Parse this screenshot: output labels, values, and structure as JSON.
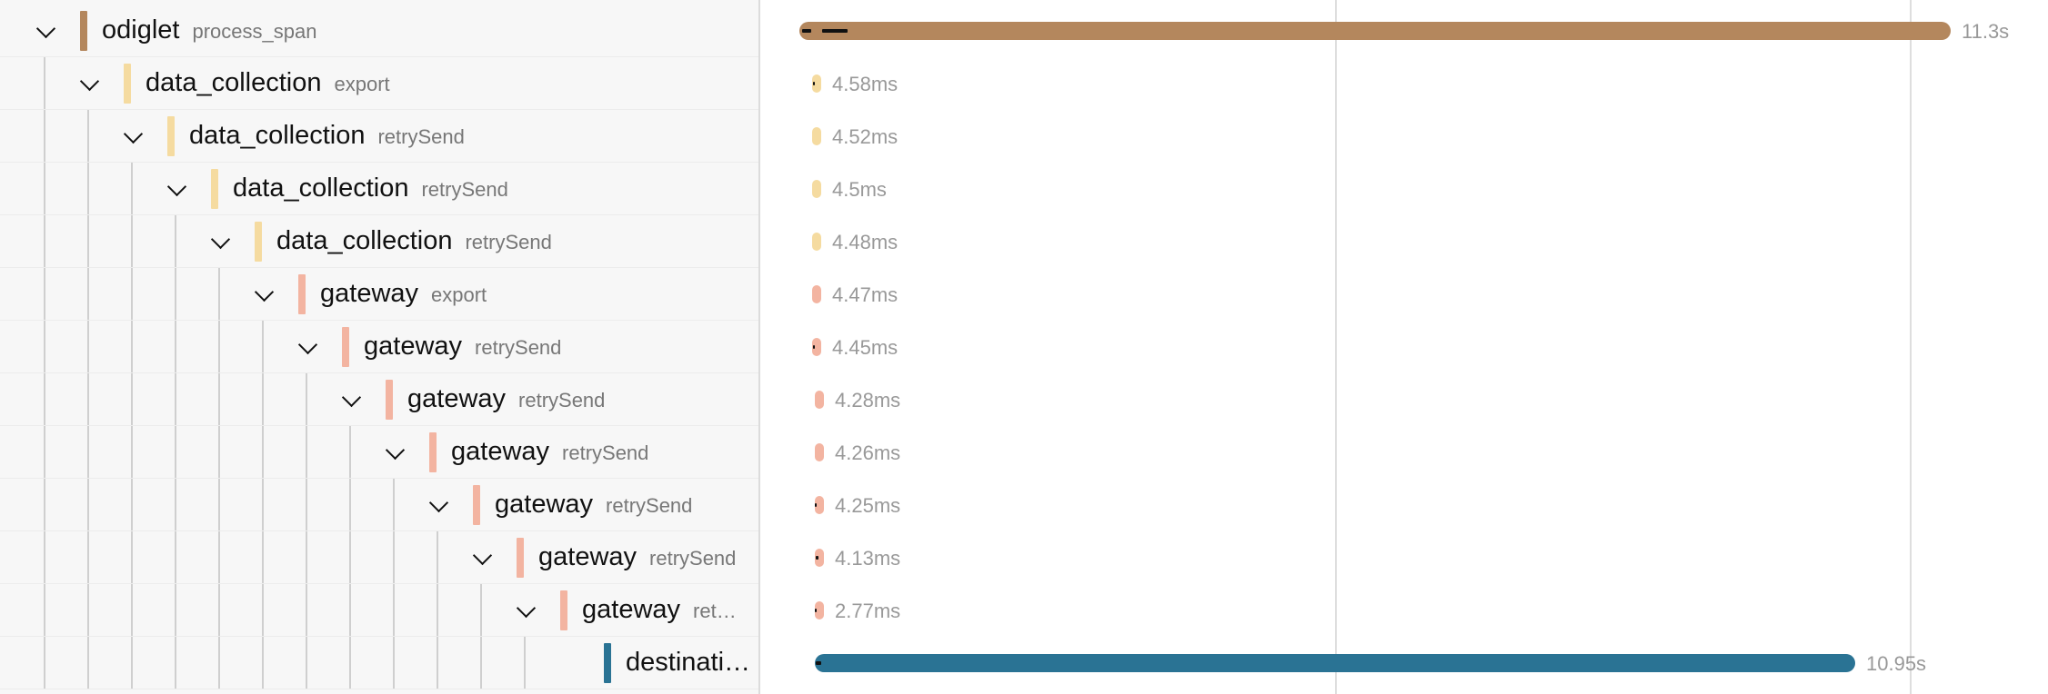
{
  "colors": {
    "odiglet": "#b4875d",
    "data_collection": "#f5dba0",
    "gateway": "#f3b4a1",
    "destination": "#2a7394"
  },
  "icons": {
    "expand": "chevron-down-icon"
  },
  "spans": [
    {
      "service": "odiglet",
      "operation": "process_span",
      "duration": "11.3s",
      "level": 0,
      "service_key": "odiglet",
      "collapsible": true
    },
    {
      "service": "data_collection",
      "operation": "export",
      "duration": "4.58ms",
      "level": 1,
      "service_key": "data_collection",
      "collapsible": true
    },
    {
      "service": "data_collection",
      "operation": "retrySend",
      "duration": "4.52ms",
      "level": 2,
      "service_key": "data_collection",
      "collapsible": true
    },
    {
      "service": "data_collection",
      "operation": "retrySend",
      "duration": "4.5ms",
      "level": 3,
      "service_key": "data_collection",
      "collapsible": true
    },
    {
      "service": "data_collection",
      "operation": "retrySend",
      "duration": "4.48ms",
      "level": 4,
      "service_key": "data_collection",
      "collapsible": true
    },
    {
      "service": "gateway",
      "operation": "export",
      "duration": "4.47ms",
      "level": 5,
      "service_key": "gateway",
      "collapsible": true
    },
    {
      "service": "gateway",
      "operation": "retrySend",
      "duration": "4.45ms",
      "level": 6,
      "service_key": "gateway",
      "collapsible": true
    },
    {
      "service": "gateway",
      "operation": "retrySend",
      "duration": "4.28ms",
      "level": 7,
      "service_key": "gateway",
      "collapsible": true
    },
    {
      "service": "gateway",
      "operation": "retrySend",
      "duration": "4.26ms",
      "level": 8,
      "service_key": "gateway",
      "collapsible": true
    },
    {
      "service": "gateway",
      "operation": "retrySend",
      "duration": "4.25ms",
      "level": 9,
      "service_key": "gateway",
      "collapsible": true
    },
    {
      "service": "gateway",
      "operation": "retrySend",
      "duration": "4.13ms",
      "level": 10,
      "service_key": "gateway",
      "collapsible": true
    },
    {
      "service": "gateway",
      "operation": "ret…",
      "duration": "2.77ms",
      "level": 11,
      "service_key": "gateway",
      "collapsible": true
    },
    {
      "service": "destinati…",
      "operation": "",
      "duration": "10.95s",
      "level": 12,
      "service_key": "destination",
      "collapsible": false
    }
  ]
}
